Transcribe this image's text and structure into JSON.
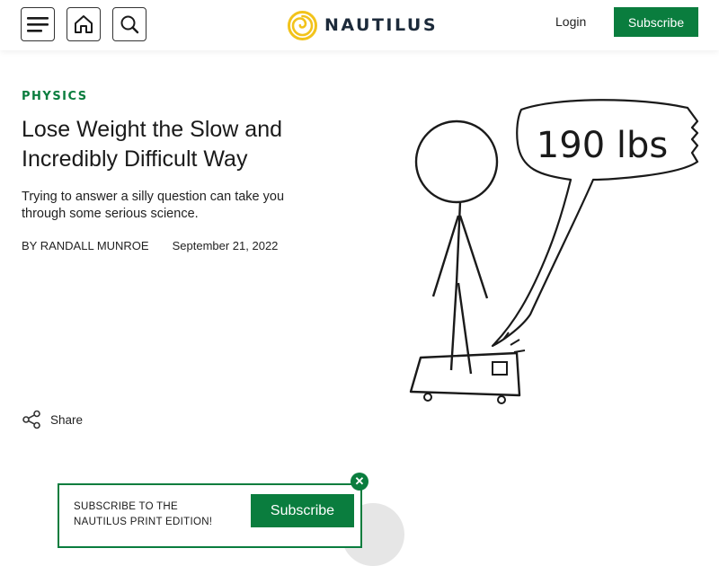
{
  "header": {
    "menu_icon": "menu-icon",
    "home_icon": "home-icon",
    "search_icon": "search-icon",
    "brand": "NAUTILUS",
    "login_label": "Login",
    "subscribe_label": "Subscribe"
  },
  "article": {
    "category": "PHYSICS",
    "title": "Lose Weight the Slow and Incredibly Difficult Way",
    "subtitle": "Trying to answer a silly question can take you through some serious science.",
    "author": "BY RANDALL MUNROE",
    "date": "September 21, 2022",
    "share_label": "Share",
    "illustration_caption": "190 lbs"
  },
  "promo": {
    "text": "SUBSCRIBE TO THE NAUTILUS PRINT EDITION!",
    "button_label": "Subscribe"
  },
  "colors": {
    "accent": "#0a7d3e",
    "logo_yellow": "#f2c31b"
  }
}
